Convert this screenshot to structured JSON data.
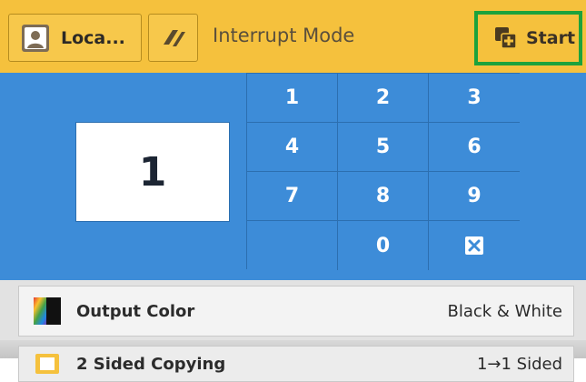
{
  "header": {
    "user_label": "Loca...",
    "mode_label": "Interrupt Mode",
    "start_label": "Start"
  },
  "quantity": {
    "value": "1"
  },
  "keypad": {
    "keys": [
      "1",
      "2",
      "3",
      "4",
      "5",
      "6",
      "7",
      "8",
      "9",
      "0"
    ],
    "clear_icon": "clear-icon"
  },
  "features": [
    {
      "title": "Output Color",
      "value": "Black & White",
      "icon": "output-color-icon"
    },
    {
      "title": "2 Sided Copying",
      "value": "1→1 Sided",
      "icon": "two-sided-icon"
    }
  ],
  "colors": {
    "header_bg": "#f5c13d",
    "keypad_bg": "#3d8cd8",
    "start_highlight": "#1ca23c"
  }
}
